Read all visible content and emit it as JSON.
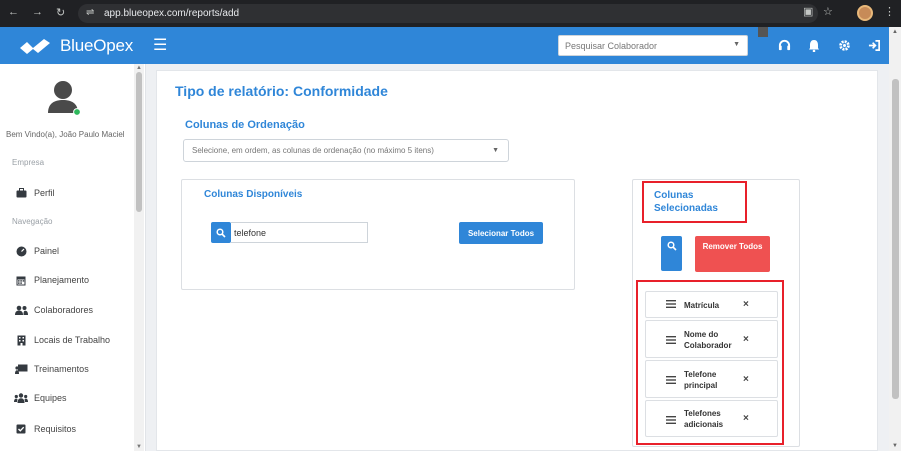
{
  "browser": {
    "url": "app.blueopex.com/reports/add"
  },
  "topbar": {
    "brand": "BlueOpex",
    "search_placeholder": "Pesquisar Colaborador",
    "accent_color": "#2f86d8"
  },
  "sidebar": {
    "welcome": "Bem Vindo(a), João Paulo Maciel",
    "section_company": "Empresa",
    "section_nav": "Navegação",
    "company_items": [
      {
        "label": "Perfil",
        "icon": "briefcase-icon"
      }
    ],
    "nav_items": [
      {
        "label": "Painel",
        "icon": "dashboard-icon"
      },
      {
        "label": "Planejamento",
        "icon": "calendar-icon"
      },
      {
        "label": "Colaboradores",
        "icon": "users-icon"
      },
      {
        "label": "Locais de Trabalho",
        "icon": "building-icon"
      },
      {
        "label": "Treinamentos",
        "icon": "chalkboard-icon"
      },
      {
        "label": "Equipes",
        "icon": "team-icon"
      },
      {
        "label": "Requisitos",
        "icon": "checkbox-icon"
      }
    ]
  },
  "main": {
    "title": "Tipo de relatório: Conformidade",
    "ordering_title": "Colunas de Ordenação",
    "ordering_placeholder": "Selecione, em ordem, as colunas de ordenação (no máximo 5 itens)",
    "available": {
      "title": "Colunas Disponíveis",
      "search_value": "telefone",
      "select_all_label": "Selecionar Todos"
    },
    "selected": {
      "title": "Colunas Selecionadas",
      "remove_all_label": "Remover Todos",
      "items": [
        {
          "label": "Matrícula"
        },
        {
          "label": "Nome do Colaborador"
        },
        {
          "label": "Telefone principal"
        },
        {
          "label": "Telefones adicionais"
        }
      ],
      "highlight_color": "#e8202a",
      "remove_color": "#ef5151"
    }
  }
}
